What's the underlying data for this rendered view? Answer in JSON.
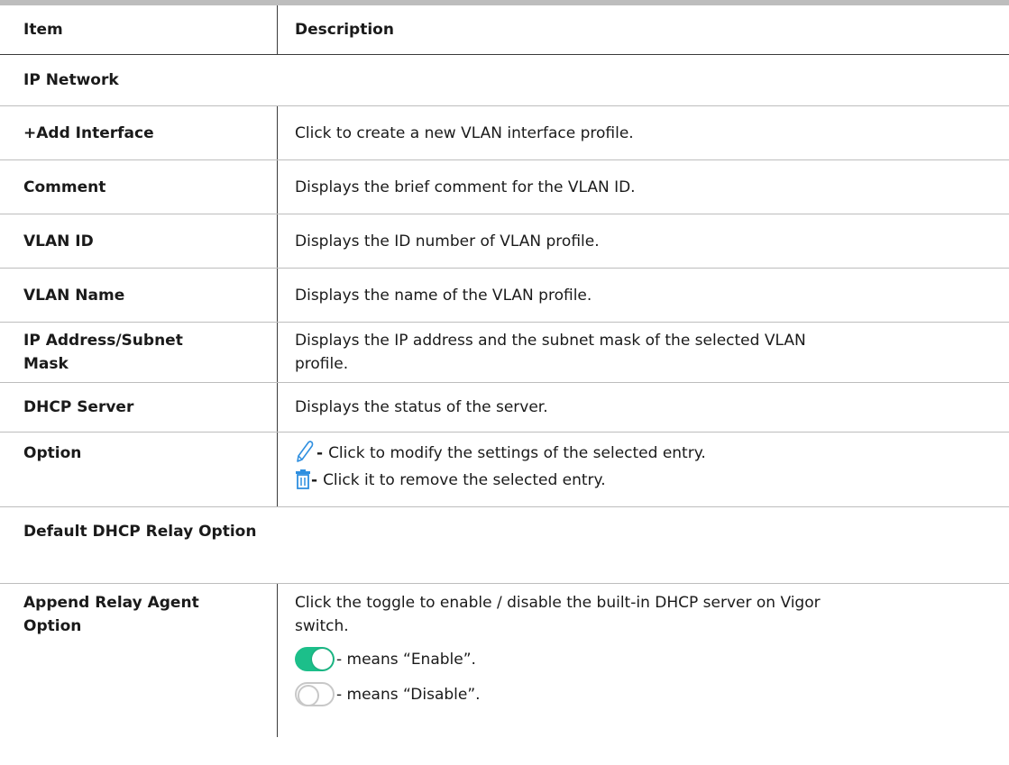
{
  "header": {
    "item": "Item",
    "description": "Description"
  },
  "sections": {
    "ip_network": "IP Network",
    "default_dhcp_relay": "Default DHCP Relay Option"
  },
  "rows": {
    "add_interface": {
      "item": "+Add Interface",
      "description": "Click to create a new VLAN interface profile."
    },
    "comment": {
      "item": "Comment",
      "description": "Displays the brief comment for the VLAN ID."
    },
    "vlan_id": {
      "item": "VLAN ID",
      "description": "Displays the ID number of VLAN profile."
    },
    "vlan_name": {
      "item": "VLAN Name",
      "description": "Displays the name of the VLAN profile."
    },
    "ip_address": {
      "item_line1": "IP Address/Subnet",
      "item_line2": "Mask",
      "description_line1": "Displays the IP address and the subnet mask of the selected VLAN",
      "description_line2": "profile."
    },
    "dhcp_server": {
      "item": "DHCP Server",
      "description": "Displays the status of the server."
    },
    "option": {
      "item": "Option",
      "edit_dash": "-",
      "edit_text": "Click to modify the settings of the selected entry.",
      "delete_dash": "-",
      "delete_text": "Click it to remove the selected entry."
    },
    "append_relay": {
      "item_line1": "Append Relay Agent",
      "item_line2": "Option",
      "description_line1": "Click the toggle to enable / disable the built-in DHCP server on Vigor",
      "description_line2": "switch.",
      "enable_text": "- means “Enable”.",
      "disable_text": "- means “Disable”."
    }
  },
  "icons": {
    "edit": "pencil-icon",
    "delete": "trash-icon",
    "toggle_on": "toggle-on-icon",
    "toggle_off": "toggle-off-icon"
  },
  "colors": {
    "toggle_on": "#1cbf8a",
    "icon_blue": "#2f8fe0",
    "rule": "#bdbdbd"
  }
}
